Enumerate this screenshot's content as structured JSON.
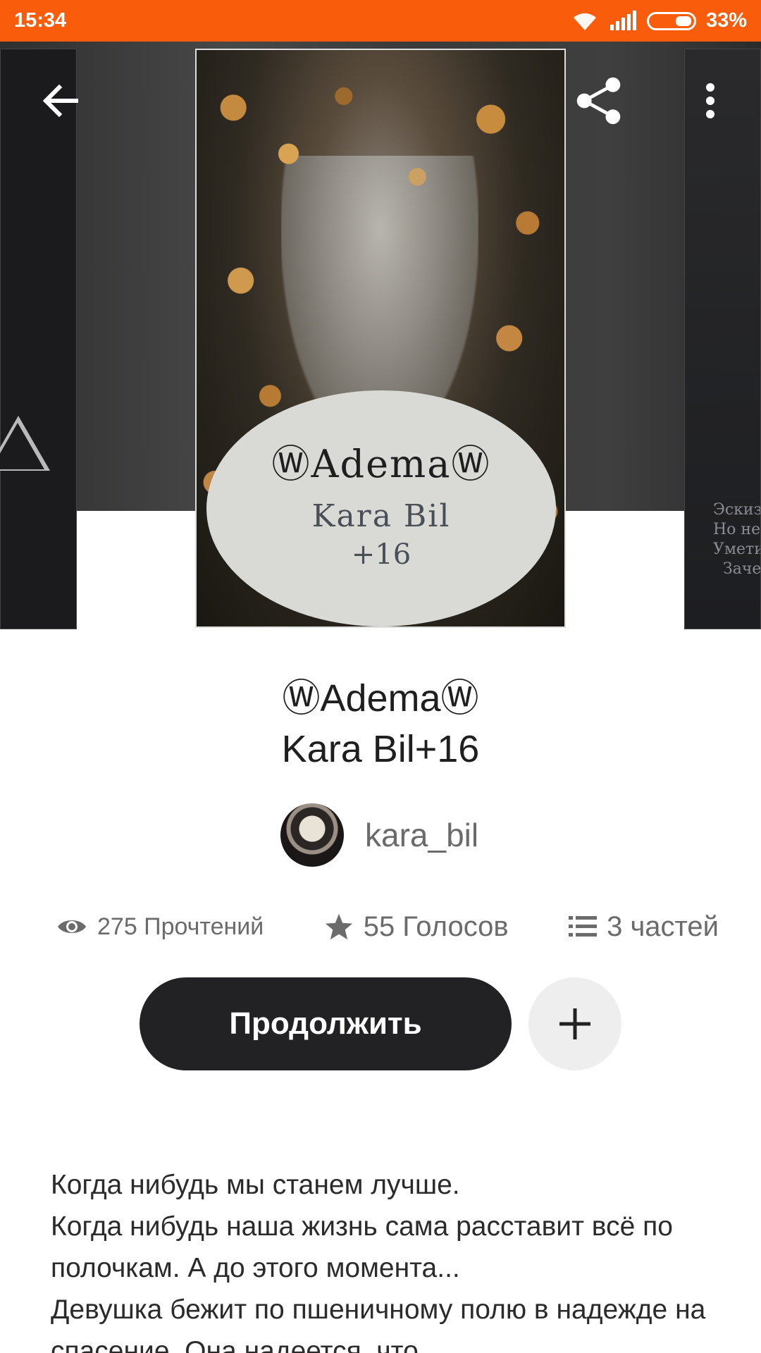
{
  "status_bar": {
    "time": "15:34",
    "battery": "33%"
  },
  "side_right_snippet": [
    "Эскиз",
    "Но не",
    "Умети",
    "Заче"
  ],
  "cover": {
    "title": "ⓌAdemaⓌ",
    "author": "Kara Bil",
    "age": "+16"
  },
  "story": {
    "title_line1": "ⓌAdemaⓌ",
    "title_line2": "Kara Bil+16",
    "author": "kara_bil"
  },
  "stats": {
    "reads": "275 Прочтений",
    "votes": "55 Голосов",
    "parts": "3 частей"
  },
  "actions": {
    "continue": "Продолжить"
  },
  "description": [
    "Когда нибудь мы станем лучше.",
    "Когда нибудь наша жизнь сама расставит всё по полочкам. А до этого момента...",
    "Девушка бежит по пшеничному полю в надежде на спасение. Она надеется, что"
  ],
  "icons": {
    "back": "arrow-left-icon",
    "share": "share-icon",
    "more": "more-vertical-icon",
    "reads": "eye-icon",
    "votes": "star-icon",
    "parts": "list-icon",
    "add": "plus-icon"
  },
  "colors": {
    "accent": "#f95c0b",
    "button": "#222124"
  }
}
